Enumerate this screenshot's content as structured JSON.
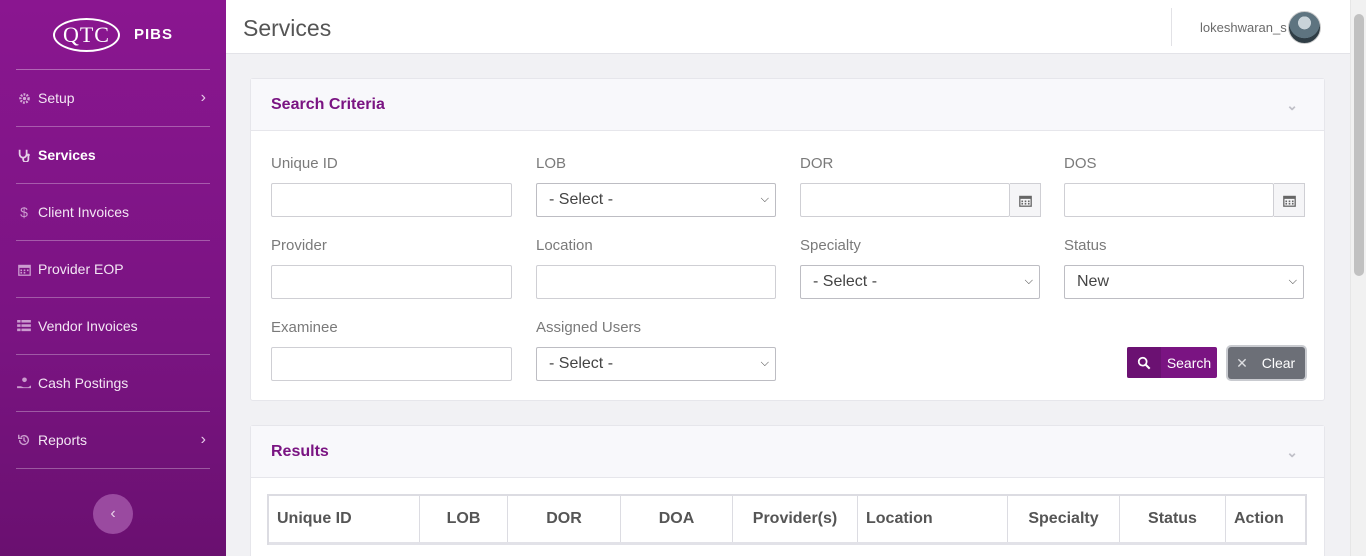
{
  "brand": {
    "logo": "QTC",
    "app": "PIBS"
  },
  "sidebar": {
    "items": [
      {
        "label": "Setup",
        "icon": "gear-icon",
        "has_submenu": true
      },
      {
        "label": "Services",
        "icon": "stethoscope-icon",
        "active": true
      },
      {
        "label": "Client Invoices",
        "icon": "dollar-icon"
      },
      {
        "label": "Provider EOP",
        "icon": "calendar-icon"
      },
      {
        "label": "Vendor Invoices",
        "icon": "table-icon"
      },
      {
        "label": "Cash Postings",
        "icon": "hand-coin-icon"
      },
      {
        "label": "Reports",
        "icon": "history-icon",
        "has_submenu": true
      }
    ],
    "collapse_icon": "chevron-left-icon"
  },
  "header": {
    "title": "Services",
    "username": "lokeshwaran_s"
  },
  "search": {
    "title": "Search Criteria",
    "fields": {
      "unique_id": {
        "label": "Unique ID",
        "value": ""
      },
      "lob": {
        "label": "LOB",
        "selected": "- Select -"
      },
      "dor": {
        "label": "DOR",
        "value": ""
      },
      "dos": {
        "label": "DOS",
        "value": ""
      },
      "provider": {
        "label": "Provider",
        "value": ""
      },
      "location": {
        "label": "Location",
        "value": ""
      },
      "specialty": {
        "label": "Specialty",
        "selected": "- Select -"
      },
      "status": {
        "label": "Status",
        "selected": "New"
      },
      "examinee": {
        "label": "Examinee",
        "value": ""
      },
      "assigned_users": {
        "label": "Assigned Users",
        "selected": "- Select -"
      }
    },
    "search_button": "Search",
    "clear_button": "Clear"
  },
  "results": {
    "title": "Results",
    "columns": [
      "Unique ID",
      "LOB",
      "DOR",
      "DOA",
      "Provider(s)",
      "Location",
      "Specialty",
      "Status",
      "Action"
    ]
  },
  "colors": {
    "brand_purple": "#7a1482",
    "clear_gray": "#6c6f77"
  }
}
